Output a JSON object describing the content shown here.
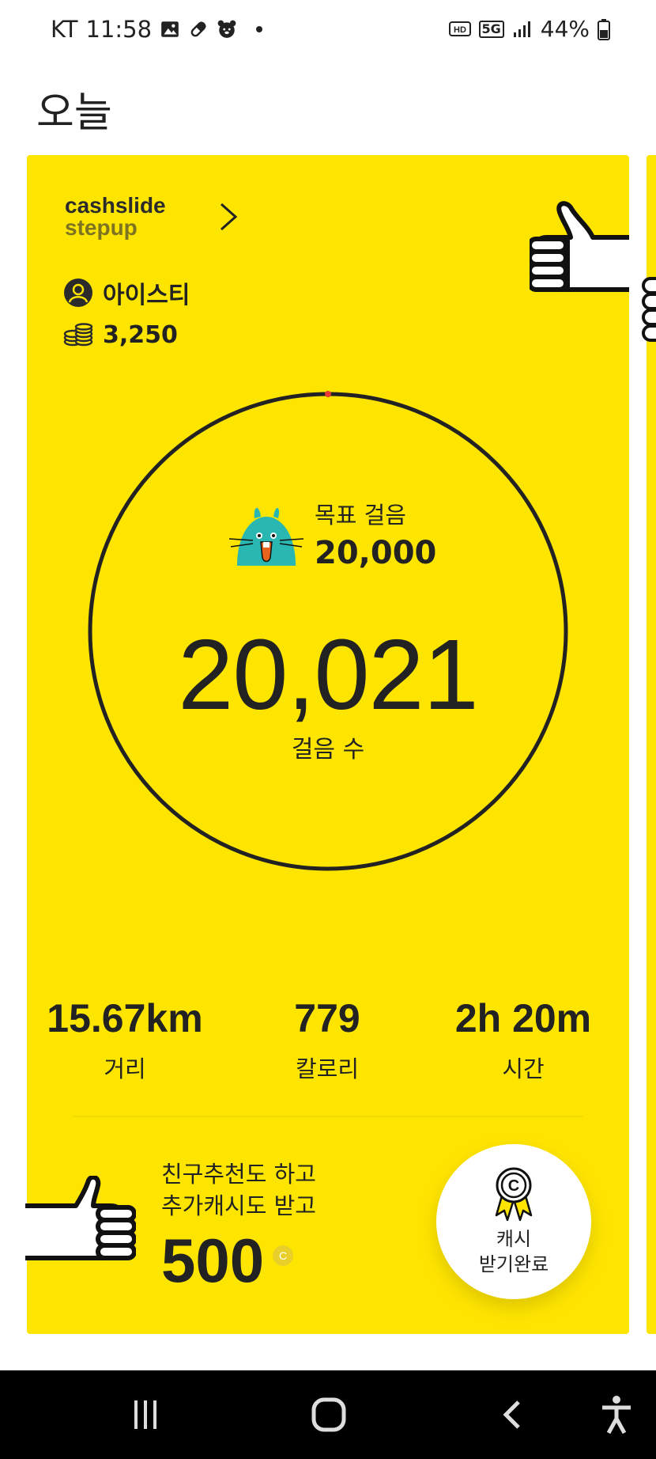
{
  "status_bar": {
    "carrier": "KT",
    "time": "11:58",
    "network": "5G",
    "battery": "44%"
  },
  "page": {
    "title": "오늘"
  },
  "card": {
    "logo_line1": "cashslide",
    "logo_line2": "stepup",
    "user_name": "아이스티",
    "coin_balance": "3,250",
    "goal_label": "목표 걸음",
    "goal_value": "20,000",
    "steps_value": "20,021",
    "steps_label": "걸음 수",
    "progress": 1.0,
    "stats": [
      {
        "value": "15.67km",
        "label": "거리"
      },
      {
        "value": "779",
        "label": "칼로리"
      },
      {
        "value": "2h 20m",
        "label": "시간"
      }
    ],
    "promo_line1": "친구추천도 하고",
    "promo_line2": "추가캐시도 받고",
    "promo_value": "500",
    "cash_button_line1": "캐시",
    "cash_button_line2": "받기완료"
  },
  "colors": {
    "card_bg": "#fee500",
    "ring": "#222222",
    "ring_marker": "#e53935",
    "mascot": "#2ab7b1",
    "nav_bg": "#000000"
  },
  "icons": {
    "status": [
      "gallery-icon",
      "pill-icon",
      "alarm-bear-icon"
    ],
    "nav": [
      "recents-icon",
      "home-icon",
      "back-icon",
      "accessibility-icon"
    ]
  }
}
